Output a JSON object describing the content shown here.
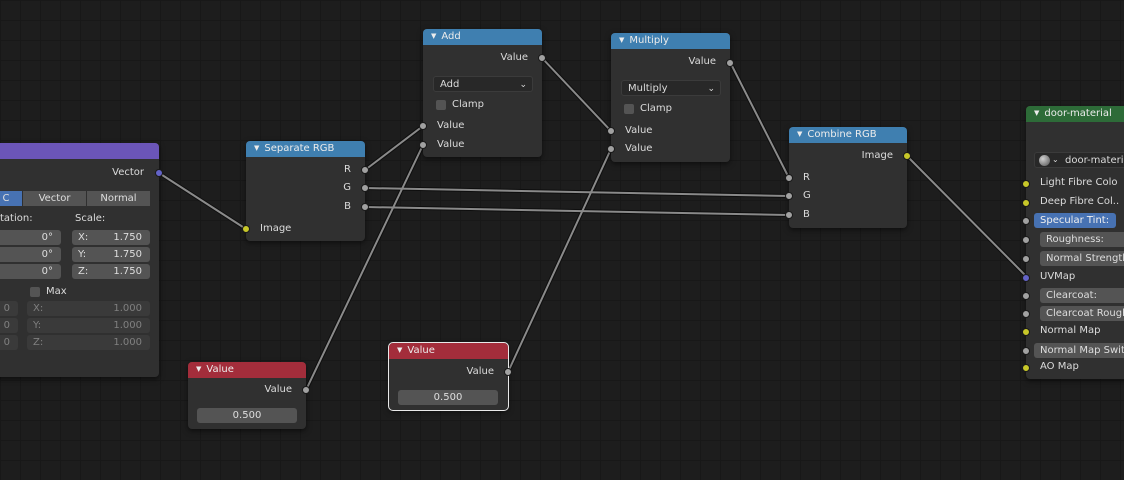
{
  "nodes": {
    "mapping": {
      "output_label": "Vector",
      "tabs": [
        "C",
        "Vector",
        "Normal"
      ],
      "rotation_label": "tation:",
      "scale_label": "Scale:",
      "rotation": [
        {
          "axis": "",
          "value": "0°"
        },
        {
          "axis": "",
          "value": "0°"
        },
        {
          "axis": "",
          "value": "0°"
        }
      ],
      "scale": [
        {
          "axis": "X:",
          "value": "1.750"
        },
        {
          "axis": "Y:",
          "value": "1.750"
        },
        {
          "axis": "Z:",
          "value": "1.750"
        }
      ],
      "max_label": "Max",
      "min": [
        {
          "axis": "",
          "value": "0"
        },
        {
          "axis": "",
          "value": "0"
        },
        {
          "axis": "",
          "value": "0"
        }
      ],
      "max": [
        {
          "axis": "X:",
          "value": "1.000"
        },
        {
          "axis": "Y:",
          "value": "1.000"
        },
        {
          "axis": "Z:",
          "value": "1.000"
        }
      ]
    },
    "separate_rgb": {
      "title": "Separate RGB",
      "outputs": [
        "R",
        "G",
        "B"
      ],
      "input": "Image"
    },
    "add": {
      "title": "Add",
      "output": "Value",
      "operation": "Add",
      "clamp": "Clamp",
      "inputs": [
        "Value",
        "Value"
      ]
    },
    "multiply": {
      "title": "Multiply",
      "output": "Value",
      "operation": "Multiply",
      "clamp": "Clamp",
      "inputs": [
        "Value",
        "Value"
      ]
    },
    "combine_rgb": {
      "title": "Combine RGB",
      "output": "Image",
      "inputs": [
        "R",
        "G",
        "B"
      ]
    },
    "value1": {
      "title": "Value",
      "output": "Value",
      "value": "0.500"
    },
    "value2": {
      "title": "Value",
      "output": "Value",
      "value": "0.500"
    },
    "door_material": {
      "title": "door-material",
      "datablock": "door-materia",
      "inputs": [
        "Light Fibre Colo",
        "Deep Fibre Col..",
        "Specular Tint:",
        "Roughness:",
        "Normal Strength",
        "UVMap",
        "Clearcoat:",
        "Clearcoat Rough",
        "Normal Map",
        "Normal Map Switc",
        "AO Map"
      ]
    }
  },
  "colors": {
    "converter_header": "#3f7fb0",
    "input_header": "#a32d3b",
    "vector_header": "#6b55b8",
    "group_header": "#2d6b38",
    "socket_float": "#a1a1a1",
    "socket_color": "#c7c729",
    "socket_vector": "#6363c7",
    "wire": "#8a8a8a"
  }
}
